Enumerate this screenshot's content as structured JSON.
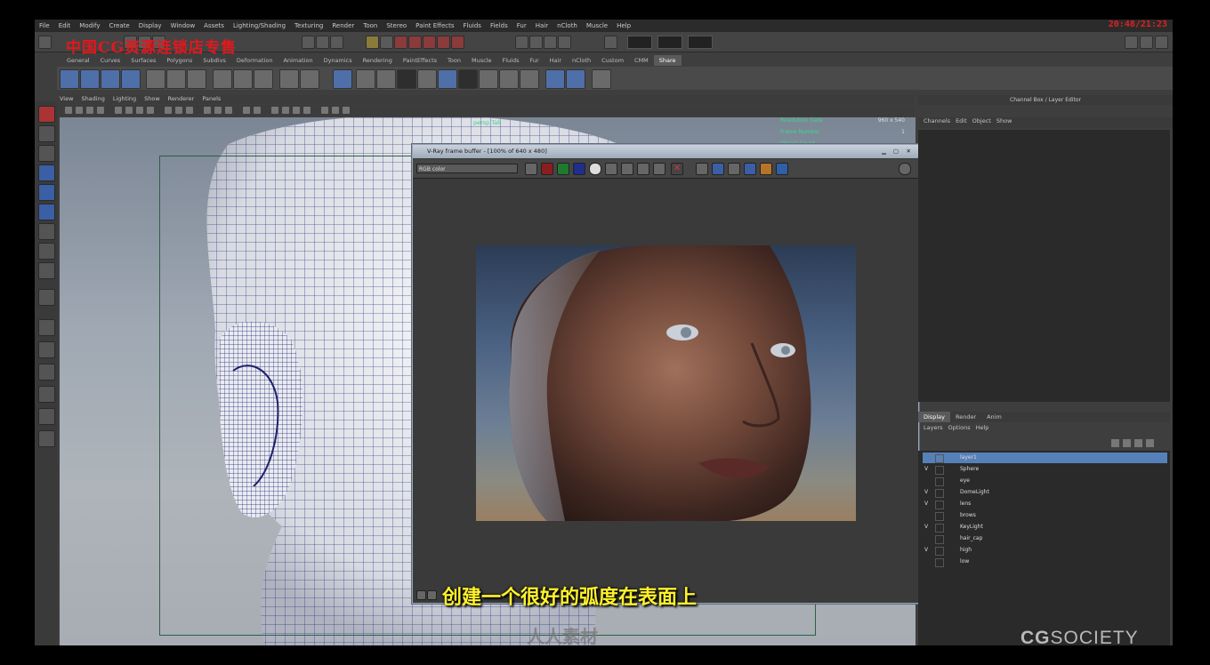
{
  "clock": "20:48/21:23",
  "menu": [
    "File",
    "Edit",
    "Modify",
    "Create",
    "Display",
    "Window",
    "Assets",
    "Lighting/Shading",
    "Texturing",
    "Render",
    "Toon",
    "Stereo",
    "Paint Effects",
    "Fluids",
    "Fields",
    "Fur",
    "Hair",
    "nCloth",
    "Muscle",
    "Help"
  ],
  "watermark_top": "中国CG资源连锁店专售",
  "shelf_tabs": [
    "General",
    "Curves",
    "Surfaces",
    "Polygons",
    "Subdivs",
    "Deformation",
    "Animation",
    "Dynamics",
    "Rendering",
    "PaintEffects",
    "Toon",
    "Muscle",
    "Fluids",
    "Fur",
    "Hair",
    "nCloth",
    "Custom",
    "CMM",
    "Share"
  ],
  "shelf_active": "Share",
  "viewport_menu": [
    "View",
    "Shading",
    "Lighting",
    "Show",
    "Renderer",
    "Panels"
  ],
  "viewport_label": "persp Tab",
  "hud": [
    {
      "k": "Resolution Gate",
      "v": "960 x 540"
    },
    {
      "k": "Frame Number",
      "v": "1"
    },
    {
      "k": "Object Count",
      "v": "—"
    },
    {
      "k": "Poly Count",
      "v": "—"
    }
  ],
  "frame_buffer": {
    "title": "V-Ray frame buffer - [100% of 640 x 480]",
    "channel": "RGB color"
  },
  "right_panel": {
    "title": "Channel Box / Layer Editor",
    "menu": [
      "Channels",
      "Edit",
      "Object",
      "Show"
    ]
  },
  "layer_tabs": [
    "Display",
    "Render",
    "Anim"
  ],
  "layer_tab_active": "Display",
  "layer_menu": [
    "Layers",
    "Options",
    "Help"
  ],
  "layers": [
    {
      "name": "layer1",
      "vis": "",
      "selected": true
    },
    {
      "name": "Sphere",
      "vis": "V",
      "selected": false
    },
    {
      "name": "eye",
      "vis": "",
      "selected": false
    },
    {
      "name": "DomeLight",
      "vis": "V",
      "selected": false
    },
    {
      "name": "lens",
      "vis": "V",
      "selected": false
    },
    {
      "name": "brows",
      "vis": "",
      "selected": false
    },
    {
      "name": "KeyLight",
      "vis": "V",
      "selected": false
    },
    {
      "name": "hair_cap",
      "vis": "",
      "selected": false
    },
    {
      "name": "high",
      "vis": "V",
      "selected": false
    },
    {
      "name": "low",
      "vis": "",
      "selected": false
    }
  ],
  "subtitle": "创建一个很好的弧度在表面上",
  "logo": {
    "bold": "CG",
    "thin": "SOCIETY"
  },
  "site_mark": "人人素材"
}
